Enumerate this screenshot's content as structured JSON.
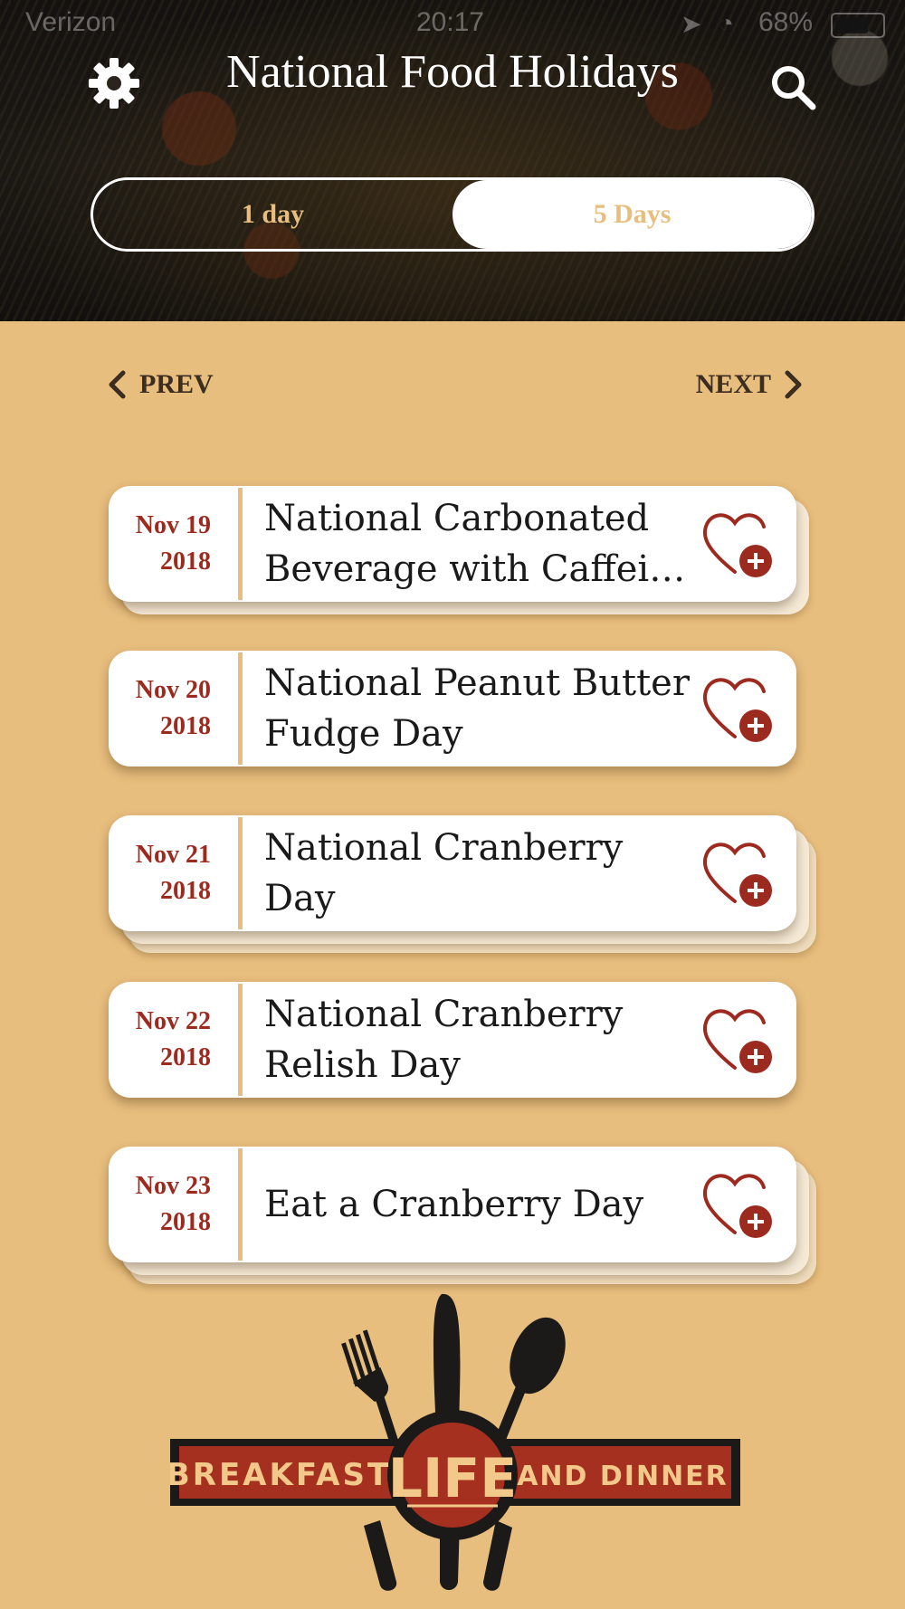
{
  "status": {
    "carrier": "Verizon",
    "time": "20:17",
    "battery": "68%"
  },
  "header": {
    "title": "National Food Holidays",
    "settings_icon": "gear-icon",
    "search_icon": "search-icon"
  },
  "range_toggle": {
    "options": [
      {
        "label": "1 day",
        "selected": false
      },
      {
        "label": "5 Days",
        "selected": true
      }
    ]
  },
  "pager": {
    "prev_label": "PREV",
    "next_label": "NEXT"
  },
  "holidays": [
    {
      "date": "Nov 19",
      "year": "2018",
      "title": "National Carbonated Beverage with Caffei…"
    },
    {
      "date": "Nov 20",
      "year": "2018",
      "title": "National Peanut Butter Fudge Day"
    },
    {
      "date": "Nov 21",
      "year": "2018",
      "title": "National Cranberry Day"
    },
    {
      "date": "Nov 22",
      "year": "2018",
      "title": "National Cranberry Relish Day"
    },
    {
      "date": "Nov 23",
      "year": "2018",
      "title": "Eat a Cranberry Day"
    }
  ],
  "logo": {
    "left_text": "BREAKFAST",
    "center_text": "LIFE",
    "right_text": "AND DINNER"
  },
  "colors": {
    "background": "#e8be7e",
    "accent_red": "#9c2a1e",
    "text_dark": "#3b2d20"
  }
}
